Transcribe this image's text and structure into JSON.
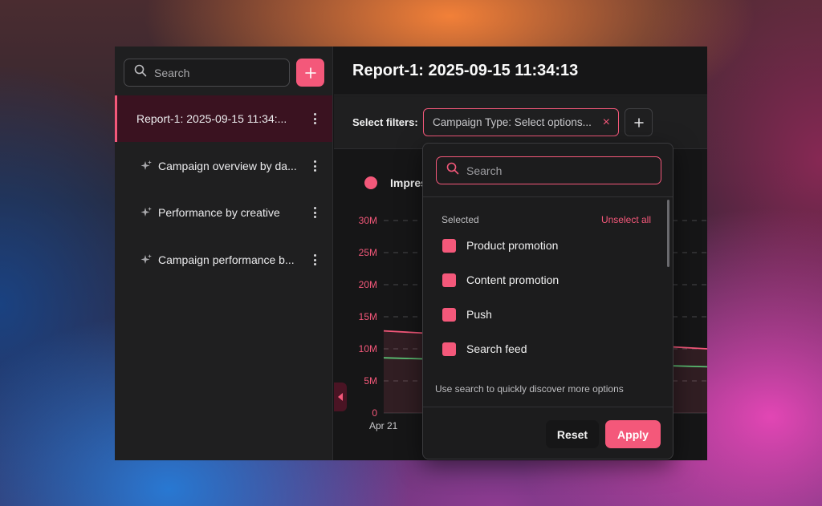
{
  "colors": {
    "accent": "#f4587a",
    "line_green": "#5bbf73",
    "panel": "#1f1f20"
  },
  "sidebar": {
    "search_placeholder": "Search",
    "add_icon": "plus-icon",
    "items": [
      {
        "label": "Report-1: 2025-09-15 11:34:...",
        "active": true
      },
      {
        "label": "Campaign overview by da...",
        "icon": "sparkle-icon"
      },
      {
        "label": "Performance by creative",
        "icon": "sparkle-icon"
      },
      {
        "label": "Campaign performance b...",
        "icon": "sparkle-icon"
      }
    ]
  },
  "header": {
    "title": "Report-1: 2025-09-15 11:34:13"
  },
  "filters": {
    "label": "Select filters:",
    "chip_text": "Campaign Type: Select options...",
    "clear_symbol": "×"
  },
  "chart": {
    "legend_visible_text": "Impres",
    "y_ticks": [
      "30M",
      "25M",
      "20M",
      "15M",
      "10M",
      "5M",
      "0"
    ],
    "x_first_label": "Apr 21"
  },
  "chart_data": {
    "type": "area",
    "x": [
      "Apr 21"
    ],
    "ylim": [
      0,
      30000000
    ],
    "grid": true,
    "series": [
      {
        "name": "Impres",
        "color": "#f4587a",
        "start_value": 12800000,
        "end_value": 10000000
      },
      {
        "color": "#5bbf73",
        "start_value": 8600000,
        "end_value": 7200000
      }
    ]
  },
  "dropdown": {
    "search_placeholder": "Search",
    "selected_label": "Selected",
    "unselect_all": "Unselect all",
    "options": [
      {
        "label": "Product promotion",
        "checked": true
      },
      {
        "label": "Content promotion",
        "checked": true
      },
      {
        "label": "Push",
        "checked": true
      },
      {
        "label": "Search feed",
        "checked": true
      }
    ],
    "hint": "Use search to quickly discover more options",
    "reset_label": "Reset",
    "apply_label": "Apply"
  }
}
